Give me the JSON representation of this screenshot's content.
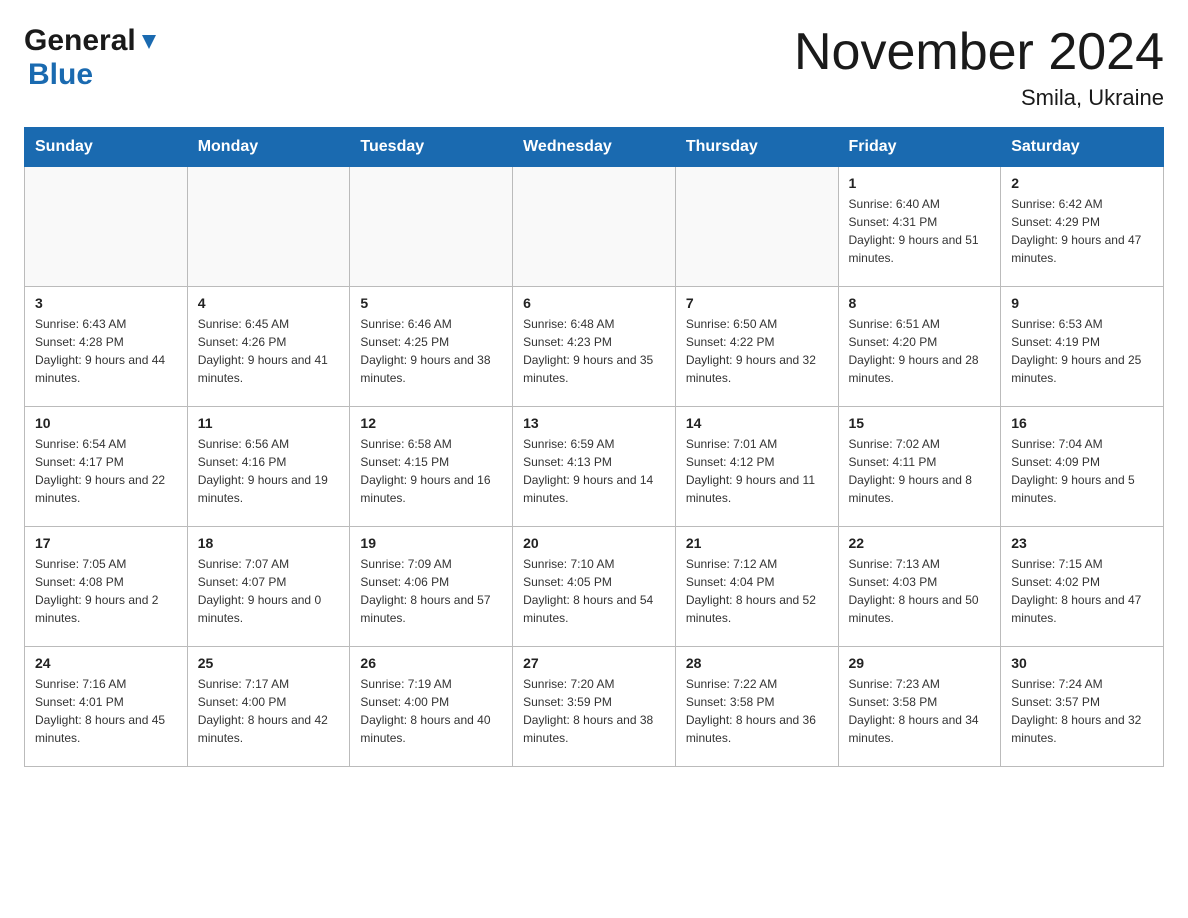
{
  "logo": {
    "general": "General",
    "blue": "Blue"
  },
  "title": {
    "month_year": "November 2024",
    "location": "Smila, Ukraine"
  },
  "weekdays": [
    "Sunday",
    "Monday",
    "Tuesday",
    "Wednesday",
    "Thursday",
    "Friday",
    "Saturday"
  ],
  "weeks": [
    [
      {
        "day": "",
        "sunrise": "",
        "sunset": "",
        "daylight": ""
      },
      {
        "day": "",
        "sunrise": "",
        "sunset": "",
        "daylight": ""
      },
      {
        "day": "",
        "sunrise": "",
        "sunset": "",
        "daylight": ""
      },
      {
        "day": "",
        "sunrise": "",
        "sunset": "",
        "daylight": ""
      },
      {
        "day": "",
        "sunrise": "",
        "sunset": "",
        "daylight": ""
      },
      {
        "day": "1",
        "sunrise": "Sunrise: 6:40 AM",
        "sunset": "Sunset: 4:31 PM",
        "daylight": "Daylight: 9 hours and 51 minutes."
      },
      {
        "day": "2",
        "sunrise": "Sunrise: 6:42 AM",
        "sunset": "Sunset: 4:29 PM",
        "daylight": "Daylight: 9 hours and 47 minutes."
      }
    ],
    [
      {
        "day": "3",
        "sunrise": "Sunrise: 6:43 AM",
        "sunset": "Sunset: 4:28 PM",
        "daylight": "Daylight: 9 hours and 44 minutes."
      },
      {
        "day": "4",
        "sunrise": "Sunrise: 6:45 AM",
        "sunset": "Sunset: 4:26 PM",
        "daylight": "Daylight: 9 hours and 41 minutes."
      },
      {
        "day": "5",
        "sunrise": "Sunrise: 6:46 AM",
        "sunset": "Sunset: 4:25 PM",
        "daylight": "Daylight: 9 hours and 38 minutes."
      },
      {
        "day": "6",
        "sunrise": "Sunrise: 6:48 AM",
        "sunset": "Sunset: 4:23 PM",
        "daylight": "Daylight: 9 hours and 35 minutes."
      },
      {
        "day": "7",
        "sunrise": "Sunrise: 6:50 AM",
        "sunset": "Sunset: 4:22 PM",
        "daylight": "Daylight: 9 hours and 32 minutes."
      },
      {
        "day": "8",
        "sunrise": "Sunrise: 6:51 AM",
        "sunset": "Sunset: 4:20 PM",
        "daylight": "Daylight: 9 hours and 28 minutes."
      },
      {
        "day": "9",
        "sunrise": "Sunrise: 6:53 AM",
        "sunset": "Sunset: 4:19 PM",
        "daylight": "Daylight: 9 hours and 25 minutes."
      }
    ],
    [
      {
        "day": "10",
        "sunrise": "Sunrise: 6:54 AM",
        "sunset": "Sunset: 4:17 PM",
        "daylight": "Daylight: 9 hours and 22 minutes."
      },
      {
        "day": "11",
        "sunrise": "Sunrise: 6:56 AM",
        "sunset": "Sunset: 4:16 PM",
        "daylight": "Daylight: 9 hours and 19 minutes."
      },
      {
        "day": "12",
        "sunrise": "Sunrise: 6:58 AM",
        "sunset": "Sunset: 4:15 PM",
        "daylight": "Daylight: 9 hours and 16 minutes."
      },
      {
        "day": "13",
        "sunrise": "Sunrise: 6:59 AM",
        "sunset": "Sunset: 4:13 PM",
        "daylight": "Daylight: 9 hours and 14 minutes."
      },
      {
        "day": "14",
        "sunrise": "Sunrise: 7:01 AM",
        "sunset": "Sunset: 4:12 PM",
        "daylight": "Daylight: 9 hours and 11 minutes."
      },
      {
        "day": "15",
        "sunrise": "Sunrise: 7:02 AM",
        "sunset": "Sunset: 4:11 PM",
        "daylight": "Daylight: 9 hours and 8 minutes."
      },
      {
        "day": "16",
        "sunrise": "Sunrise: 7:04 AM",
        "sunset": "Sunset: 4:09 PM",
        "daylight": "Daylight: 9 hours and 5 minutes."
      }
    ],
    [
      {
        "day": "17",
        "sunrise": "Sunrise: 7:05 AM",
        "sunset": "Sunset: 4:08 PM",
        "daylight": "Daylight: 9 hours and 2 minutes."
      },
      {
        "day": "18",
        "sunrise": "Sunrise: 7:07 AM",
        "sunset": "Sunset: 4:07 PM",
        "daylight": "Daylight: 9 hours and 0 minutes."
      },
      {
        "day": "19",
        "sunrise": "Sunrise: 7:09 AM",
        "sunset": "Sunset: 4:06 PM",
        "daylight": "Daylight: 8 hours and 57 minutes."
      },
      {
        "day": "20",
        "sunrise": "Sunrise: 7:10 AM",
        "sunset": "Sunset: 4:05 PM",
        "daylight": "Daylight: 8 hours and 54 minutes."
      },
      {
        "day": "21",
        "sunrise": "Sunrise: 7:12 AM",
        "sunset": "Sunset: 4:04 PM",
        "daylight": "Daylight: 8 hours and 52 minutes."
      },
      {
        "day": "22",
        "sunrise": "Sunrise: 7:13 AM",
        "sunset": "Sunset: 4:03 PM",
        "daylight": "Daylight: 8 hours and 50 minutes."
      },
      {
        "day": "23",
        "sunrise": "Sunrise: 7:15 AM",
        "sunset": "Sunset: 4:02 PM",
        "daylight": "Daylight: 8 hours and 47 minutes."
      }
    ],
    [
      {
        "day": "24",
        "sunrise": "Sunrise: 7:16 AM",
        "sunset": "Sunset: 4:01 PM",
        "daylight": "Daylight: 8 hours and 45 minutes."
      },
      {
        "day": "25",
        "sunrise": "Sunrise: 7:17 AM",
        "sunset": "Sunset: 4:00 PM",
        "daylight": "Daylight: 8 hours and 42 minutes."
      },
      {
        "day": "26",
        "sunrise": "Sunrise: 7:19 AM",
        "sunset": "Sunset: 4:00 PM",
        "daylight": "Daylight: 8 hours and 40 minutes."
      },
      {
        "day": "27",
        "sunrise": "Sunrise: 7:20 AM",
        "sunset": "Sunset: 3:59 PM",
        "daylight": "Daylight: 8 hours and 38 minutes."
      },
      {
        "day": "28",
        "sunrise": "Sunrise: 7:22 AM",
        "sunset": "Sunset: 3:58 PM",
        "daylight": "Daylight: 8 hours and 36 minutes."
      },
      {
        "day": "29",
        "sunrise": "Sunrise: 7:23 AM",
        "sunset": "Sunset: 3:58 PM",
        "daylight": "Daylight: 8 hours and 34 minutes."
      },
      {
        "day": "30",
        "sunrise": "Sunrise: 7:24 AM",
        "sunset": "Sunset: 3:57 PM",
        "daylight": "Daylight: 8 hours and 32 minutes."
      }
    ]
  ]
}
